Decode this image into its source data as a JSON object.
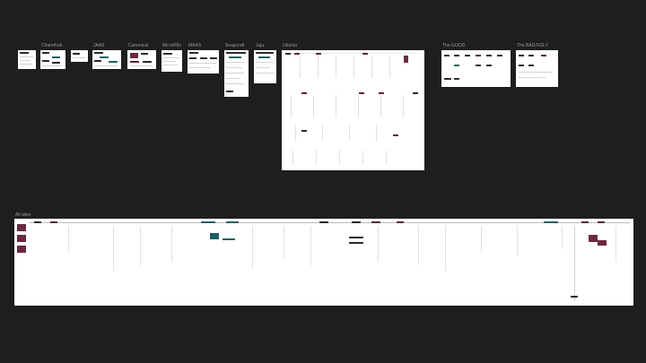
{
  "canvas": {
    "background": "#1e1e1e"
  },
  "frames": [
    {
      "id": "frame-untitled",
      "label": ""
    },
    {
      "id": "frame-charmhub",
      "label": "Charmhub"
    },
    {
      "id": "frame-untitled-2",
      "label": ""
    },
    {
      "id": "frame-jaas",
      "label": "JAAS"
    },
    {
      "id": "frame-canonical",
      "label": "Canonical"
    },
    {
      "id": "frame-microk8s",
      "label": "MicroK8s"
    },
    {
      "id": "frame-maas",
      "label": "MAAS"
    },
    {
      "id": "frame-snapcraft",
      "label": "Snapcraft"
    },
    {
      "id": "frame-juju",
      "label": "Juju"
    },
    {
      "id": "frame-ubuntu",
      "label": "Ubuntu"
    },
    {
      "id": "frame-the-good",
      "label": "The GOOD"
    },
    {
      "id": "frame-the-bad-ugly",
      "label": "The BAD/UGLY"
    },
    {
      "id": "frame-all-sites",
      "label": "All sites"
    }
  ],
  "colors": {
    "frame_fill": "#ffffff",
    "label_text": "#9a9a9a",
    "accent_teal": "#1f5f63",
    "accent_maroon": "#5a2233",
    "dark_block": "#2a2a2a"
  }
}
